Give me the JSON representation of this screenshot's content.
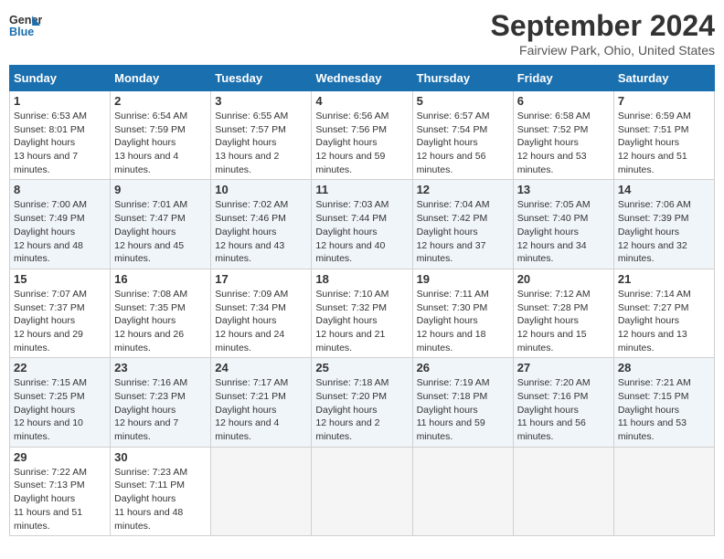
{
  "logo": {
    "line1": "General",
    "line2": "Blue"
  },
  "title": "September 2024",
  "subtitle": "Fairview Park, Ohio, United States",
  "days_of_week": [
    "Sunday",
    "Monday",
    "Tuesday",
    "Wednesday",
    "Thursday",
    "Friday",
    "Saturday"
  ],
  "weeks": [
    [
      {
        "day": 1,
        "sunrise": "6:53 AM",
        "sunset": "8:01 PM",
        "daylight": "13 hours and 7 minutes."
      },
      {
        "day": 2,
        "sunrise": "6:54 AM",
        "sunset": "7:59 PM",
        "daylight": "13 hours and 4 minutes."
      },
      {
        "day": 3,
        "sunrise": "6:55 AM",
        "sunset": "7:57 PM",
        "daylight": "13 hours and 2 minutes."
      },
      {
        "day": 4,
        "sunrise": "6:56 AM",
        "sunset": "7:56 PM",
        "daylight": "12 hours and 59 minutes."
      },
      {
        "day": 5,
        "sunrise": "6:57 AM",
        "sunset": "7:54 PM",
        "daylight": "12 hours and 56 minutes."
      },
      {
        "day": 6,
        "sunrise": "6:58 AM",
        "sunset": "7:52 PM",
        "daylight": "12 hours and 53 minutes."
      },
      {
        "day": 7,
        "sunrise": "6:59 AM",
        "sunset": "7:51 PM",
        "daylight": "12 hours and 51 minutes."
      }
    ],
    [
      {
        "day": 8,
        "sunrise": "7:00 AM",
        "sunset": "7:49 PM",
        "daylight": "12 hours and 48 minutes."
      },
      {
        "day": 9,
        "sunrise": "7:01 AM",
        "sunset": "7:47 PM",
        "daylight": "12 hours and 45 minutes."
      },
      {
        "day": 10,
        "sunrise": "7:02 AM",
        "sunset": "7:46 PM",
        "daylight": "12 hours and 43 minutes."
      },
      {
        "day": 11,
        "sunrise": "7:03 AM",
        "sunset": "7:44 PM",
        "daylight": "12 hours and 40 minutes."
      },
      {
        "day": 12,
        "sunrise": "7:04 AM",
        "sunset": "7:42 PM",
        "daylight": "12 hours and 37 minutes."
      },
      {
        "day": 13,
        "sunrise": "7:05 AM",
        "sunset": "7:40 PM",
        "daylight": "12 hours and 34 minutes."
      },
      {
        "day": 14,
        "sunrise": "7:06 AM",
        "sunset": "7:39 PM",
        "daylight": "12 hours and 32 minutes."
      }
    ],
    [
      {
        "day": 15,
        "sunrise": "7:07 AM",
        "sunset": "7:37 PM",
        "daylight": "12 hours and 29 minutes."
      },
      {
        "day": 16,
        "sunrise": "7:08 AM",
        "sunset": "7:35 PM",
        "daylight": "12 hours and 26 minutes."
      },
      {
        "day": 17,
        "sunrise": "7:09 AM",
        "sunset": "7:34 PM",
        "daylight": "12 hours and 24 minutes."
      },
      {
        "day": 18,
        "sunrise": "7:10 AM",
        "sunset": "7:32 PM",
        "daylight": "12 hours and 21 minutes."
      },
      {
        "day": 19,
        "sunrise": "7:11 AM",
        "sunset": "7:30 PM",
        "daylight": "12 hours and 18 minutes."
      },
      {
        "day": 20,
        "sunrise": "7:12 AM",
        "sunset": "7:28 PM",
        "daylight": "12 hours and 15 minutes."
      },
      {
        "day": 21,
        "sunrise": "7:14 AM",
        "sunset": "7:27 PM",
        "daylight": "12 hours and 13 minutes."
      }
    ],
    [
      {
        "day": 22,
        "sunrise": "7:15 AM",
        "sunset": "7:25 PM",
        "daylight": "12 hours and 10 minutes."
      },
      {
        "day": 23,
        "sunrise": "7:16 AM",
        "sunset": "7:23 PM",
        "daylight": "12 hours and 7 minutes."
      },
      {
        "day": 24,
        "sunrise": "7:17 AM",
        "sunset": "7:21 PM",
        "daylight": "12 hours and 4 minutes."
      },
      {
        "day": 25,
        "sunrise": "7:18 AM",
        "sunset": "7:20 PM",
        "daylight": "12 hours and 2 minutes."
      },
      {
        "day": 26,
        "sunrise": "7:19 AM",
        "sunset": "7:18 PM",
        "daylight": "11 hours and 59 minutes."
      },
      {
        "day": 27,
        "sunrise": "7:20 AM",
        "sunset": "7:16 PM",
        "daylight": "11 hours and 56 minutes."
      },
      {
        "day": 28,
        "sunrise": "7:21 AM",
        "sunset": "7:15 PM",
        "daylight": "11 hours and 53 minutes."
      }
    ],
    [
      {
        "day": 29,
        "sunrise": "7:22 AM",
        "sunset": "7:13 PM",
        "daylight": "11 hours and 51 minutes."
      },
      {
        "day": 30,
        "sunrise": "7:23 AM",
        "sunset": "7:11 PM",
        "daylight": "11 hours and 48 minutes."
      },
      null,
      null,
      null,
      null,
      null
    ]
  ]
}
